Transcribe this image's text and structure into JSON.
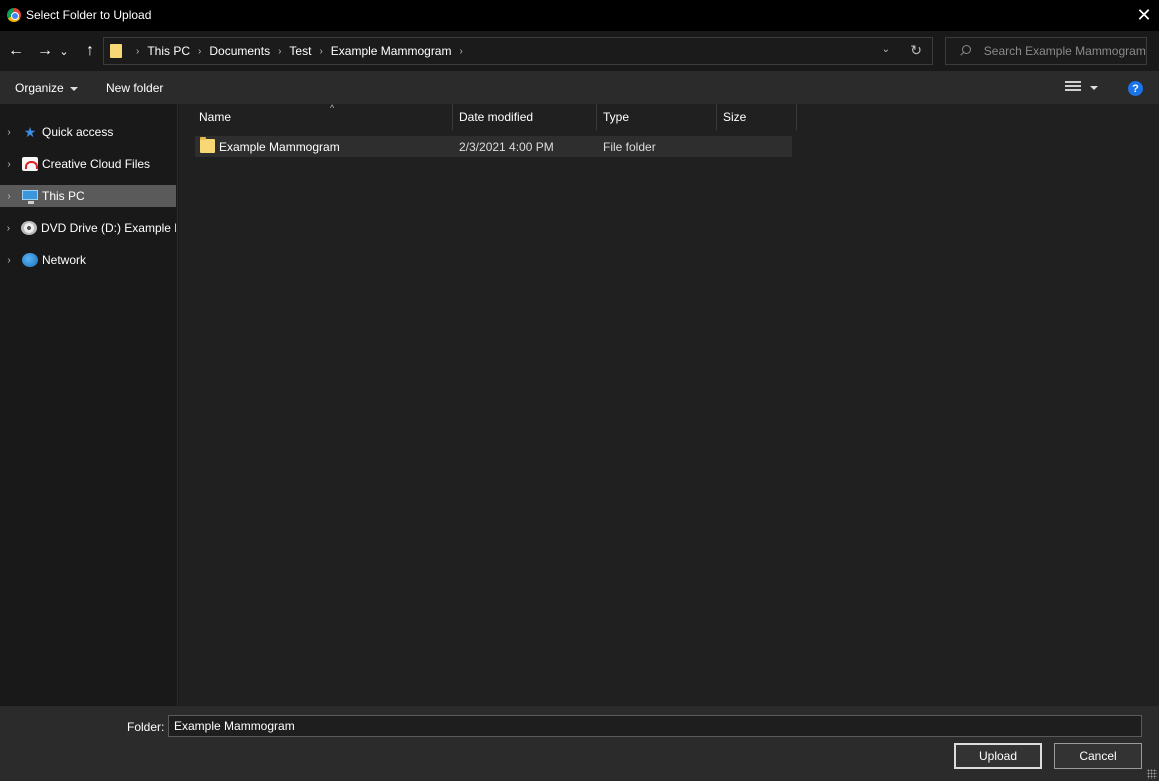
{
  "window": {
    "title": "Select Folder to Upload",
    "close_glyph": "✕",
    "app_icon": "chrome-icon"
  },
  "nav": {
    "back_glyph": "←",
    "forward_glyph": "→",
    "recent_glyph": "⌄",
    "up_glyph": "↑",
    "breadcrumbs": [
      "This PC",
      "Documents",
      "Test",
      "Example Mammogram"
    ],
    "breadcrumb_sep": "›",
    "dropdown_glyph": "⌄",
    "refresh_glyph": "↻",
    "search_placeholder": "Search Example Mammogram"
  },
  "toolbar": {
    "organize_label": "Organize",
    "new_folder_label": "New folder",
    "help_glyph": "?"
  },
  "sidebar": {
    "expander_glyph": "›",
    "items": [
      {
        "label": "Quick access",
        "icon": "star-icon"
      },
      {
        "label": "Creative Cloud Files",
        "icon": "creative-cloud-icon"
      },
      {
        "label": "This PC",
        "icon": "computer-icon",
        "selected": true
      },
      {
        "label": "DVD Drive (D:) Example M",
        "icon": "dvd-icon"
      },
      {
        "label": "Network",
        "icon": "network-icon"
      }
    ]
  },
  "file_list": {
    "columns": [
      "Name",
      "Date modified",
      "Type",
      "Size"
    ],
    "sort_glyph": "^",
    "rows": [
      {
        "name": "Example Mammogram",
        "date_modified": "2/3/2021 4:00 PM",
        "type": "File folder",
        "size": ""
      }
    ]
  },
  "footer": {
    "folder_label": "Folder:",
    "folder_value": "Example Mammogram",
    "upload_label": "Upload",
    "cancel_label": "Cancel"
  },
  "colors": {
    "background": "#191919",
    "toolbar": "#2b2b2b",
    "selection": "#5a5a5a",
    "folder": "#f8d775",
    "accent": "#1a73e8"
  }
}
